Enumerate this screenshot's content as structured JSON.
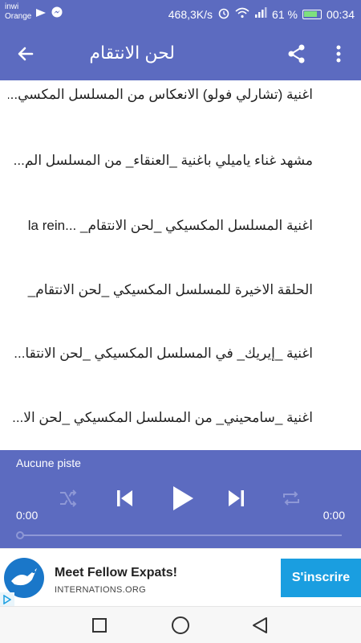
{
  "status_bar": {
    "carrier_line1": "inwi",
    "carrier_line2": "Orange",
    "net_speed": "468,3K/s",
    "battery": "61 %",
    "time": "00:34"
  },
  "app_bar": {
    "title": "لحن الانتقام",
    "back_icon": "arrow-back-icon",
    "share_icon": "share-icon",
    "menu_icon": "more-vert-icon"
  },
  "tracks": [
    {
      "title": "اغنية (تشارلي فولو) الانعكاس من المسلسل المكسي..."
    },
    {
      "title": "مشهد غناء ياميلي باغنية _العنقاء_ من المسلسل الم..."
    },
    {
      "title": "اغنية المسلسل المكسيكي _لحن الانتقام_ ...la rein"
    },
    {
      "title": "الحلقة الاخيرة للمسلسل المكسيكي _لحن الانتقام_"
    },
    {
      "title": "اغنية _إيريك_ في المسلسل المكسيكي _لحن الانتقا..."
    },
    {
      "title": "اغنية _سامحيني_ من المسلسل المكسيكي _لحن الا..."
    }
  ],
  "player": {
    "now_playing": "Aucune piste",
    "elapsed": "0:00",
    "duration": "0:00",
    "progress": 0
  },
  "ad": {
    "headline": "Meet Fellow Expats!",
    "source": "INTERNATIONS.ORG",
    "cta": "S'inscrire"
  },
  "colors": {
    "primary": "#5c6bc0",
    "ad_cta": "#1a9ee0"
  }
}
